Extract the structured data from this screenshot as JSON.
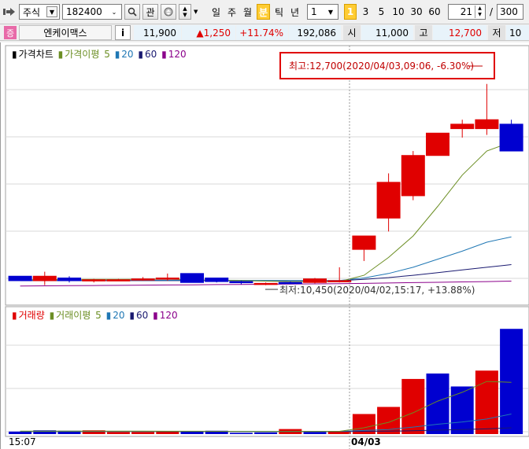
{
  "toolbar": {
    "market": "주식",
    "code": "182400",
    "watch_label": "관",
    "periods": [
      "일",
      "주",
      "월",
      "분",
      "틱",
      "년"
    ],
    "active_period": "분",
    "interval": "1",
    "interval_marker": "1",
    "quick_intervals": [
      "3",
      "5",
      "10",
      "30",
      "60"
    ],
    "count": "21",
    "slash": "/",
    "total": "300"
  },
  "quote": {
    "type_badge": "증",
    "name": "엔케이맥스",
    "info_label": "i",
    "price": "11,900",
    "change": "▲1,250",
    "change_pct": "+11.74%",
    "volume": "192,086",
    "open_label": "시",
    "open": "11,000",
    "high_label": "고",
    "high": "12,700",
    "low_label": "저",
    "low": "10"
  },
  "price_chart": {
    "legend": {
      "title": "가격차트",
      "ma_label": "가격이평",
      "ma_periods": [
        "5",
        "20",
        "60",
        "120"
      ]
    },
    "high_annotation": "최고:12,700(2020/04/03,09:06, -6.30%)",
    "low_annotation": "최저:10,450(2020/04/02,15:17, +13.88%)"
  },
  "volume_chart": {
    "legend": {
      "title": "거래량",
      "ma_label": "거래이평",
      "ma_periods": [
        "5",
        "20",
        "60",
        "120"
      ]
    }
  },
  "x_axis": {
    "labels": [
      "15:07",
      "04/03"
    ]
  },
  "colors": {
    "up": "#e00000",
    "down": "#0000d0",
    "ma5": "#6b8e23",
    "ma20": "#1f77b4",
    "ma60": "#191970",
    "ma120": "#8b008b"
  },
  "chart_data": [
    {
      "type": "candlestick",
      "title": "가격차트",
      "high_label": "최고:12,700",
      "low_label": "최저:10,450",
      "candles": [
        {
          "o": 10550,
          "h": 10550,
          "l": 10500,
          "c": 10500
        },
        {
          "o": 10500,
          "h": 10600,
          "l": 10450,
          "c": 10550
        },
        {
          "o": 10530,
          "h": 10550,
          "l": 10480,
          "c": 10500
        },
        {
          "o": 10500,
          "h": 10520,
          "l": 10480,
          "c": 10510
        },
        {
          "o": 10510,
          "h": 10520,
          "l": 10500,
          "c": 10510
        },
        {
          "o": 10520,
          "h": 10540,
          "l": 10500,
          "c": 10520
        },
        {
          "o": 10520,
          "h": 10580,
          "l": 10500,
          "c": 10530
        },
        {
          "o": 10580,
          "h": 10580,
          "l": 10480,
          "c": 10480
        },
        {
          "o": 10530,
          "h": 10530,
          "l": 10480,
          "c": 10490
        },
        {
          "o": 10490,
          "h": 10500,
          "l": 10460,
          "c": 10480
        },
        {
          "o": 10470,
          "h": 10480,
          "l": 10450,
          "c": 10470
        },
        {
          "o": 10480,
          "h": 10490,
          "l": 10460,
          "c": 10470
        },
        {
          "o": 10480,
          "h": 10530,
          "l": 10470,
          "c": 10520
        },
        {
          "o": 10490,
          "h": 10650,
          "l": 10480,
          "c": 10500
        },
        {
          "o": 10850,
          "h": 11000,
          "l": 10720,
          "c": 11000
        },
        {
          "o": 11200,
          "h": 11700,
          "l": 11050,
          "c": 11600
        },
        {
          "o": 11450,
          "h": 11950,
          "l": 11400,
          "c": 11900
        },
        {
          "o": 11900,
          "h": 12150,
          "l": 11900,
          "c": 12150
        },
        {
          "o": 12200,
          "h": 12300,
          "l": 12100,
          "c": 12250
        },
        {
          "o": 12200,
          "h": 12700,
          "l": 12130,
          "c": 12300
        },
        {
          "o": 12250,
          "h": 12300,
          "l": 11950,
          "c": 11950
        }
      ],
      "ma5": [
        10510,
        10510,
        10515,
        10515,
        10515,
        10516,
        10517,
        10510,
        10505,
        10500,
        10495,
        10490,
        10488,
        10490,
        10560,
        10760,
        11000,
        11330,
        11680,
        11950,
        12050
      ],
      "ma20": [
        10505,
        10505,
        10505,
        10505,
        10505,
        10505,
        10505,
        10505,
        10505,
        10504,
        10503,
        10502,
        10502,
        10502,
        10530,
        10580,
        10650,
        10740,
        10830,
        10930,
        10990
      ],
      "ma60": [
        10500,
        10500,
        10500,
        10500,
        10500,
        10500,
        10500,
        10500,
        10500,
        10500,
        10500,
        10500,
        10500,
        10500,
        10515,
        10535,
        10560,
        10590,
        10620,
        10650,
        10680
      ],
      "ma120": [
        10440,
        10442,
        10444,
        10446,
        10448,
        10450,
        10452,
        10454,
        10456,
        10458,
        10460,
        10462,
        10464,
        10466,
        10470,
        10474,
        10478,
        10482,
        10486,
        10490,
        10495
      ],
      "ylim": [
        10350,
        12900
      ]
    },
    {
      "type": "bar",
      "title": "거래량",
      "values": [
        600,
        900,
        800,
        900,
        500,
        500,
        700,
        600,
        800,
        300,
        400,
        1200,
        500,
        700,
        4800,
        6500,
        13200,
        14500,
        11400,
        15200,
        25200
      ],
      "directions": [
        "down",
        "down",
        "down",
        "up",
        "up",
        "up",
        "up",
        "down",
        "down",
        "down",
        "down",
        "up",
        "down",
        "up",
        "up",
        "up",
        "up",
        "down",
        "down",
        "up",
        "down"
      ],
      "ma5": [
        700,
        700,
        700,
        700,
        700,
        690,
        680,
        670,
        650,
        620,
        600,
        620,
        640,
        650,
        1500,
        2800,
        5100,
        7900,
        10000,
        12600,
        12400
      ],
      "ma20": [
        650,
        650,
        650,
        650,
        650,
        650,
        650,
        650,
        650,
        650,
        650,
        650,
        650,
        650,
        860,
        1100,
        1680,
        2350,
        2900,
        3600,
        4800
      ],
      "ma60": [
        600,
        600,
        600,
        600,
        600,
        600,
        600,
        600,
        600,
        600,
        600,
        600,
        600,
        600,
        650,
        700,
        800,
        950,
        1100,
        1250,
        1500
      ],
      "ylim": [
        0,
        27500
      ]
    }
  ]
}
